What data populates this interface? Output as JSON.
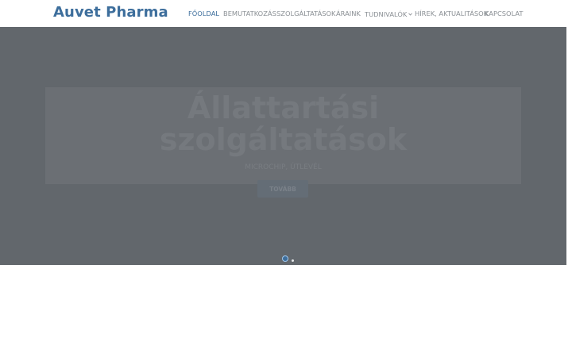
{
  "brand": {
    "name": "Auvet Pharma",
    "color": "#3d6e9c"
  },
  "nav": {
    "items": [
      {
        "label": "FŐOLDAL",
        "active": true
      },
      {
        "label": "BEMUTATKOZÁS",
        "active": false
      },
      {
        "label": "SZOLGÁLTATÁSOK",
        "active": false
      },
      {
        "label": "ÁRAINK",
        "active": false
      },
      {
        "label": "TUDNIVALÓK",
        "active": false,
        "dropdown": true,
        "icon": "chevron-down-icon"
      },
      {
        "label": "HÍREK, AKTUALITÁSOK",
        "active": false
      },
      {
        "label": "KAPCSOLAT",
        "active": false
      }
    ]
  },
  "hero": {
    "title_line1": "Állattartási",
    "title_line2": "szolgáltatások",
    "subtitle": "MICROCHIP, ÚTLEVÉL",
    "button_label": "TOVÁBB",
    "background": "#62676c"
  },
  "carousel": {
    "slide_count": 2,
    "active_index": 0
  }
}
